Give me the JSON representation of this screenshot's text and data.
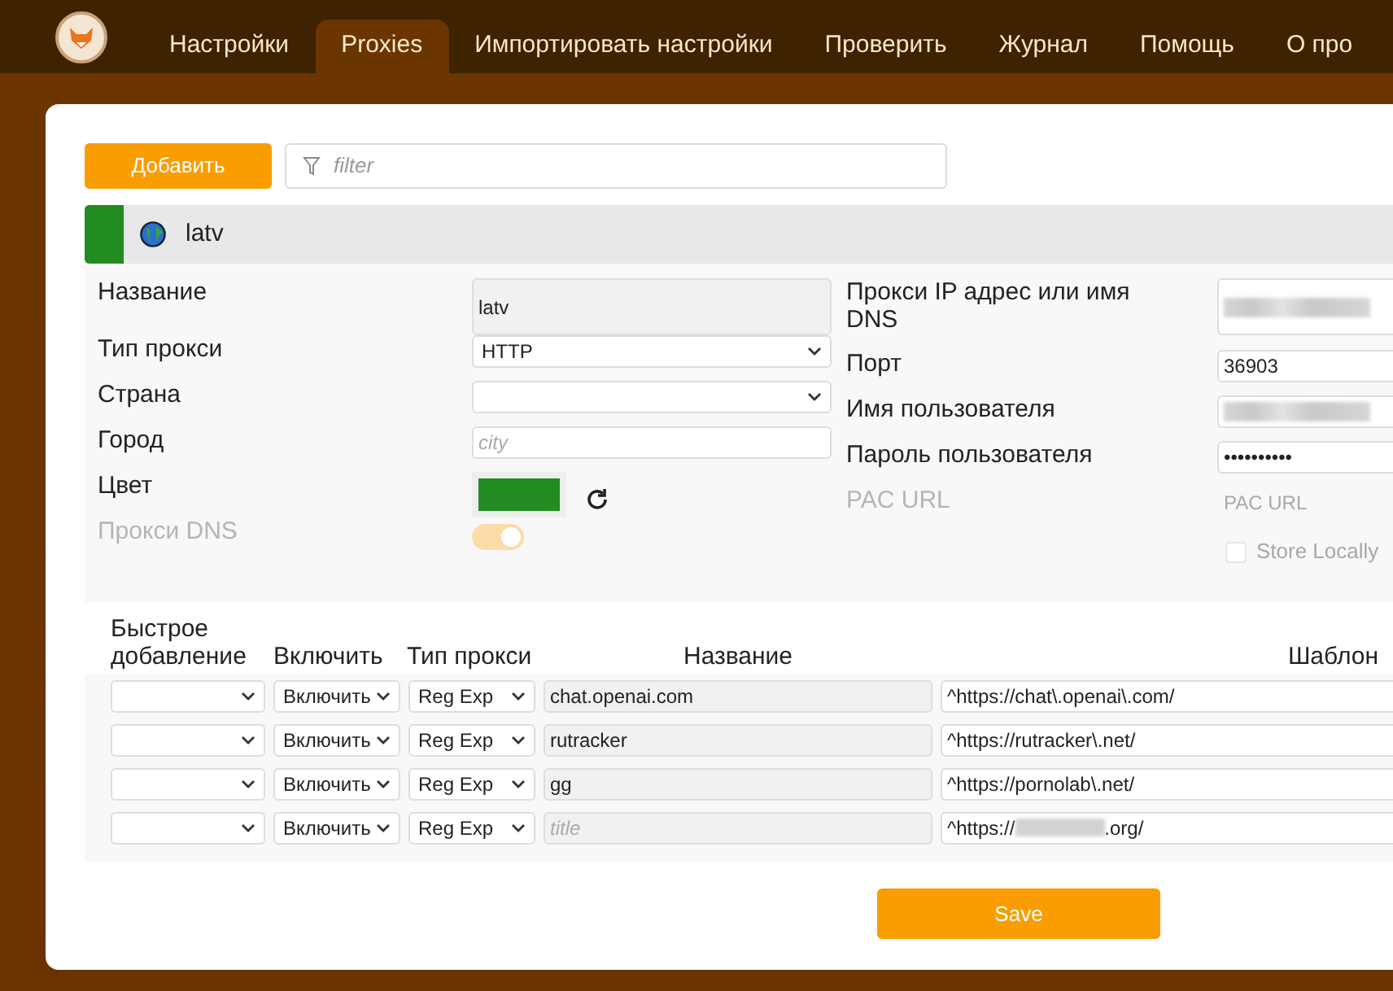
{
  "nav": {
    "tabs": [
      {
        "label": "Настройки",
        "selected": false
      },
      {
        "label": "Proxies",
        "selected": true
      },
      {
        "label": "Импортировать настройки",
        "selected": false
      },
      {
        "label": "Проверить",
        "selected": false
      },
      {
        "label": "Журнал",
        "selected": false
      },
      {
        "label": "Помощь",
        "selected": false
      },
      {
        "label": "О про",
        "selected": false
      }
    ]
  },
  "toolbar": {
    "add_button": "Добавить",
    "filter": {
      "placeholder": "filter"
    }
  },
  "proxy": {
    "title": "latv",
    "color": "#228b22",
    "left_fields": [
      {
        "kind": "text",
        "label": "Название",
        "value": "latv",
        "disabled": false
      },
      {
        "kind": "select",
        "label": "Тип прокси",
        "value": "HTTP",
        "disabled": false
      },
      {
        "kind": "select",
        "label": "Страна",
        "disabled": false
      },
      {
        "kind": "input",
        "label": "Город",
        "placeholder": "city",
        "disabled": false
      },
      {
        "kind": "color",
        "label": "Цвет",
        "disabled": false
      },
      {
        "kind": "toggle",
        "label": "Прокси DNS",
        "on": true,
        "disabled": true
      }
    ],
    "right_fields": [
      {
        "kind": "text",
        "label": "Прокси IP адрес или имя DNS",
        "redacted": true,
        "disabled": false
      },
      {
        "kind": "input",
        "label": "Порт",
        "value": "36903",
        "disabled": false
      },
      {
        "kind": "input",
        "label": "Имя пользователя",
        "redacted": true,
        "disabled": false
      },
      {
        "kind": "input",
        "label": "Пароль пользователя",
        "value": "••••••••••",
        "disabled": false
      },
      {
        "kind": "input",
        "label": "PAC URL",
        "placeholder": "PAC URL",
        "disabled": true
      },
      {
        "kind": "checkbox",
        "label": "Store Locally",
        "checked": false,
        "disabled": true
      }
    ]
  },
  "patterns": {
    "columns": [
      "Быстрое добавление",
      "Включить",
      "Тип прокси",
      "Название",
      "Шаблон"
    ],
    "rows": [
      {
        "include": "Включить",
        "type": "Reg Exp",
        "title": "chat.openai.com",
        "pattern": "^https://chat\\.openai\\.com/",
        "redacted": false
      },
      {
        "include": "Включить",
        "type": "Reg Exp",
        "title": "rutracker",
        "pattern": "^https://rutracker\\.net/",
        "redacted": false
      },
      {
        "include": "Включить",
        "type": "Reg Exp",
        "title": "gg",
        "pattern": "^https://pornolab\\.net/",
        "redacted": false
      },
      {
        "include": "Включить",
        "type": "Reg Exp",
        "title_placeholder": "title",
        "pattern": "^https://",
        "pattern_after": ".org/",
        "redacted": true
      }
    ]
  },
  "save_button": "Save"
}
